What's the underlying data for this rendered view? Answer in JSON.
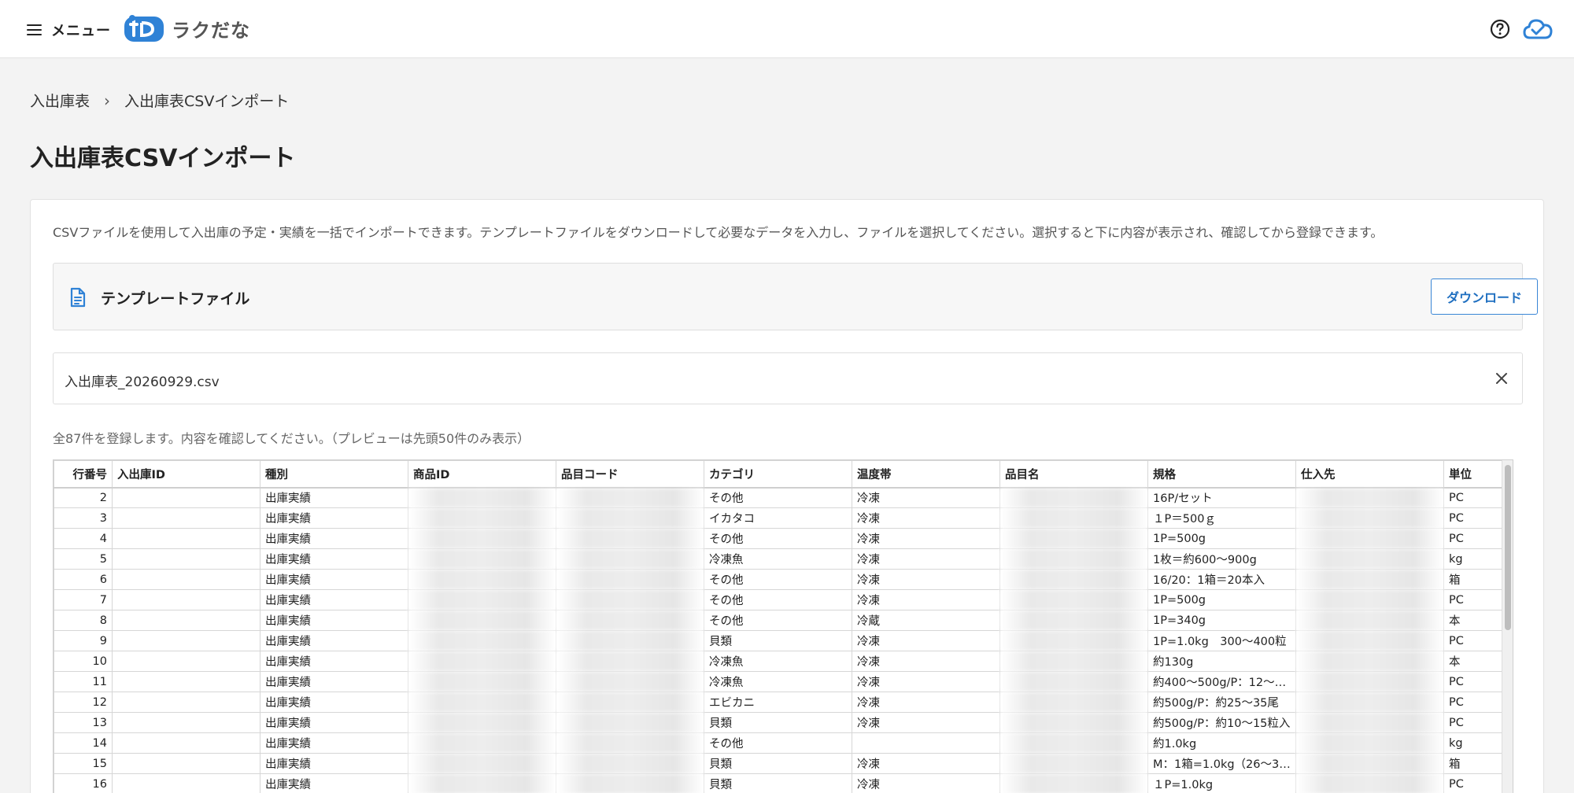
{
  "header": {
    "menu_label": "メニュー",
    "logo_text": "ラクだな",
    "brand_color": "#2f82d6"
  },
  "breadcrumb": {
    "parent": "入出庫表",
    "current": "入出庫表CSVインポート"
  },
  "page_title": "入出庫表CSVインポート",
  "card": {
    "description": "CSVファイルを使用して入出庫の予定・実績を一括でインポートできます。テンプレートファイルをダウンロードして必要なデータを入力し、ファイルを選択してください。選択すると下に内容が表示され、確認してから登録できます。",
    "template_label": "テンプレートファイル",
    "download_label": "ダウンロード",
    "file_name": "入出庫表_20260929.csv",
    "summary": "全87件を登録します。内容を確認してください。（プレビューは先頭50件のみ表示）"
  },
  "table": {
    "columns": [
      "行番号",
      "入出庫ID",
      "種別",
      "商品ID",
      "品目コード",
      "カテゴリ",
      "温度帯",
      "品目名",
      "規格",
      "仕入先",
      "単位"
    ],
    "rows": [
      [
        "2",
        "",
        "出庫実績",
        "",
        "",
        "その他",
        "冷凍",
        "",
        "16P/セット",
        "",
        "PC"
      ],
      [
        "3",
        "",
        "出庫実績",
        "",
        "",
        "イカタコ",
        "冷凍",
        "",
        "１P＝500ｇ",
        "",
        "PC"
      ],
      [
        "4",
        "",
        "出庫実績",
        "",
        "",
        "その他",
        "冷凍",
        "",
        "1P=500g",
        "",
        "PC"
      ],
      [
        "5",
        "",
        "出庫実績",
        "",
        "",
        "冷凍魚",
        "冷凍",
        "",
        "1枚＝約600〜900g",
        "",
        "kg"
      ],
      [
        "6",
        "",
        "出庫実績",
        "",
        "",
        "その他",
        "冷凍",
        "",
        "16/20：1箱＝20本入",
        "",
        "箱"
      ],
      [
        "7",
        "",
        "出庫実績",
        "",
        "",
        "その他",
        "冷凍",
        "",
        "1P=500g",
        "",
        "PC"
      ],
      [
        "8",
        "",
        "出庫実績",
        "",
        "",
        "その他",
        "冷蔵",
        "",
        "1P=340g",
        "",
        "本"
      ],
      [
        "9",
        "",
        "出庫実績",
        "",
        "",
        "貝類",
        "冷凍",
        "",
        "1P=1.0kg　300〜400粒",
        "",
        "PC"
      ],
      [
        "10",
        "",
        "出庫実績",
        "",
        "",
        "冷凍魚",
        "冷凍",
        "",
        "約130g",
        "",
        "本"
      ],
      [
        "11",
        "",
        "出庫実績",
        "",
        "",
        "冷凍魚",
        "冷凍",
        "",
        "約400〜500g/P：12〜…",
        "",
        "PC"
      ],
      [
        "12",
        "",
        "出庫実績",
        "",
        "",
        "エビカニ",
        "冷凍",
        "",
        "約500g/P：約25〜35尾",
        "",
        "PC"
      ],
      [
        "13",
        "",
        "出庫実績",
        "",
        "",
        "貝類",
        "冷凍",
        "",
        "約500g/P：約10〜15粒入",
        "",
        "PC"
      ],
      [
        "14",
        "",
        "出庫実績",
        "",
        "",
        "その他",
        "",
        "",
        "約1.0kg",
        "",
        "kg"
      ],
      [
        "15",
        "",
        "出庫実績",
        "",
        "",
        "貝類",
        "冷凍",
        "",
        "M：1箱=1.0kg（26〜3…",
        "",
        "箱"
      ],
      [
        "16",
        "",
        "出庫実績",
        "",
        "",
        "貝類",
        "冷凍",
        "",
        "１P=1.0kg",
        "",
        "PC"
      ]
    ]
  }
}
